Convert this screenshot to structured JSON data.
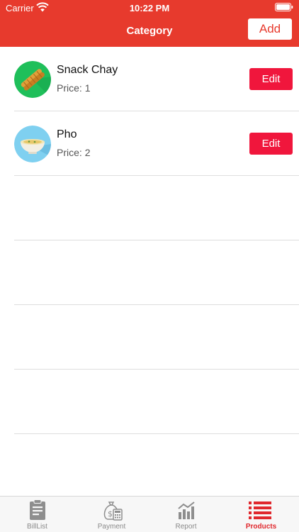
{
  "status_bar": {
    "carrier": "Carrier",
    "time": "10:22 PM"
  },
  "nav": {
    "title": "Category",
    "add_label": "Add"
  },
  "products": [
    {
      "name": "Snack Chay",
      "price_label": "Price:",
      "price": "1",
      "edit_label": "Edit",
      "icon": "fried-dough-icon"
    },
    {
      "name": "Pho",
      "price_label": "Price:",
      "price": "2",
      "edit_label": "Edit",
      "icon": "soup-bowl-icon"
    }
  ],
  "tabs": [
    {
      "label": "BillList",
      "icon": "clipboard-icon",
      "active": false
    },
    {
      "label": "Payment",
      "icon": "money-bag-calculator-icon",
      "active": false
    },
    {
      "label": "Report",
      "icon": "bar-chart-icon",
      "active": false
    },
    {
      "label": "Products",
      "icon": "list-icon",
      "active": true
    }
  ],
  "colors": {
    "header": "#e73a2d",
    "edit_button": "#f0163c",
    "active_tab": "#e0282d",
    "inactive_tab": "#8a8a8a"
  }
}
